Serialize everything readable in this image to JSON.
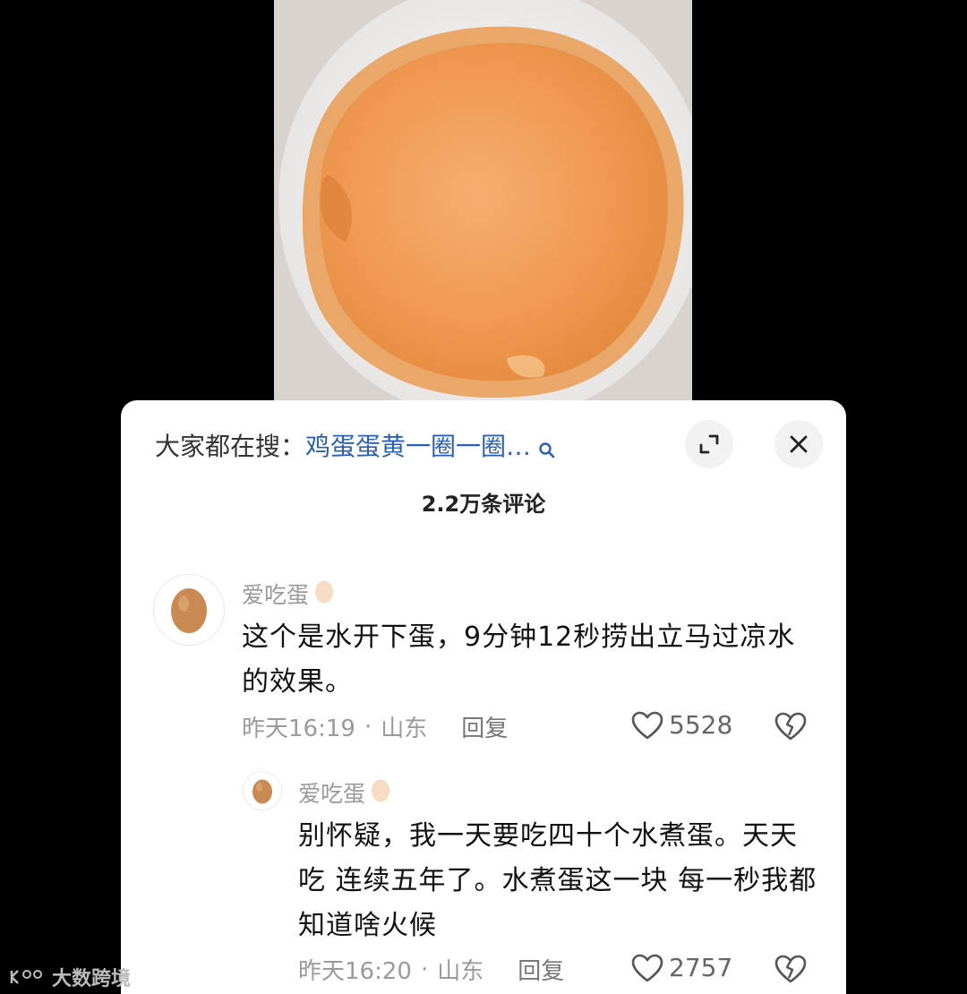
{
  "search": {
    "prefix": "大家都在搜：",
    "query": "鸡蛋蛋黄一圈一圈…"
  },
  "comments_count": "2.2万条评论",
  "comments": [
    {
      "username": "爱吃蛋",
      "text": "这个是水开下蛋，9分钟12秒捞出立马过凉水的效果。",
      "time": "昨天16:19",
      "location": "山东",
      "reply_label": "回复",
      "likes": "5528"
    },
    {
      "username": "爱吃蛋",
      "text": "别怀疑，我一天要吃四十个水煮蛋。天天吃 连续五年了。水煮蛋这一块 每一秒我都知道啥火候",
      "time": "昨天16:20",
      "location": "山东",
      "reply_label": "回复",
      "likes": "2757"
    }
  ],
  "separator": "·",
  "watermark": "大数跨境",
  "colors": {
    "link_blue": "#2b5fb3",
    "gray_text": "#9a9a9a",
    "yolk": "#f2a15e"
  },
  "icons": [
    "search-icon",
    "expand-icon",
    "close-icon",
    "heart-icon",
    "broken-heart-icon",
    "egg-avatar-icon"
  ]
}
